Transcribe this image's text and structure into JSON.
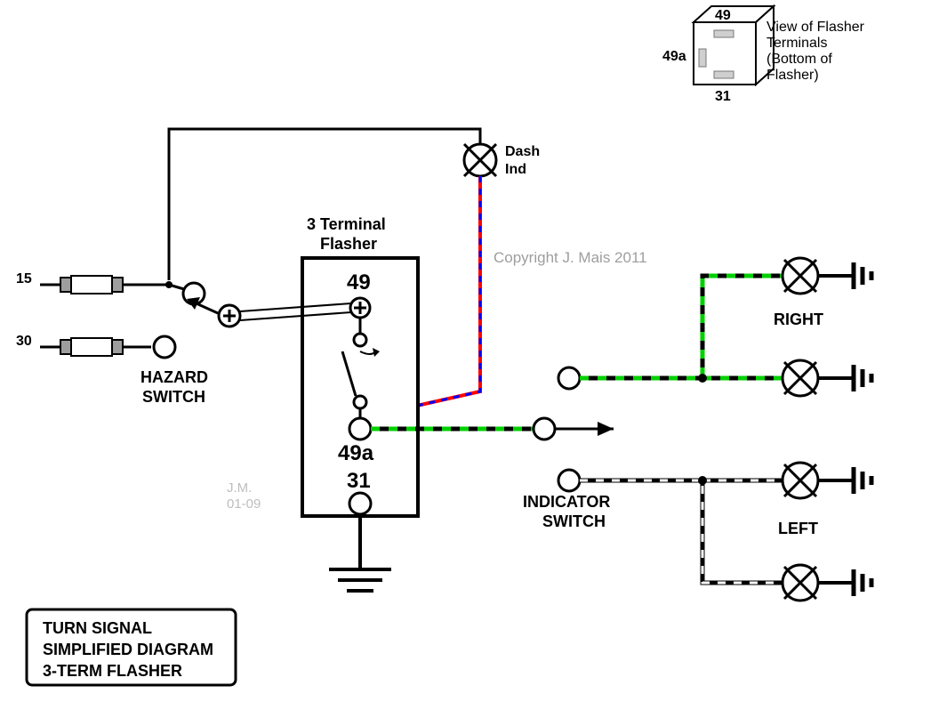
{
  "title_box": [
    "TURN SIGNAL",
    "SIMPLIFIED DIAGRAM",
    "3-TERM FLASHER"
  ],
  "flasher_box_title": "3 Terminal Flasher",
  "terminals": {
    "t49": "49",
    "t49a": "49a",
    "t31": "31"
  },
  "hazard_label": "HAZARD\nSWITCH",
  "indicator_label": "INDICATOR\nSWITCH",
  "dash_label": "Dash\nInd",
  "right_label": "RIGHT",
  "left_label": "LEFT",
  "line15": "15",
  "line30": "30",
  "jm": "J.M.\n01-09",
  "copyright": "Copyright J. Mais 2011",
  "legend_title": "View of Flasher\nTerminals\n(Bottom of\nFlasher)",
  "legend": {
    "t49": "49",
    "t49a": "49a",
    "t31": "31"
  }
}
